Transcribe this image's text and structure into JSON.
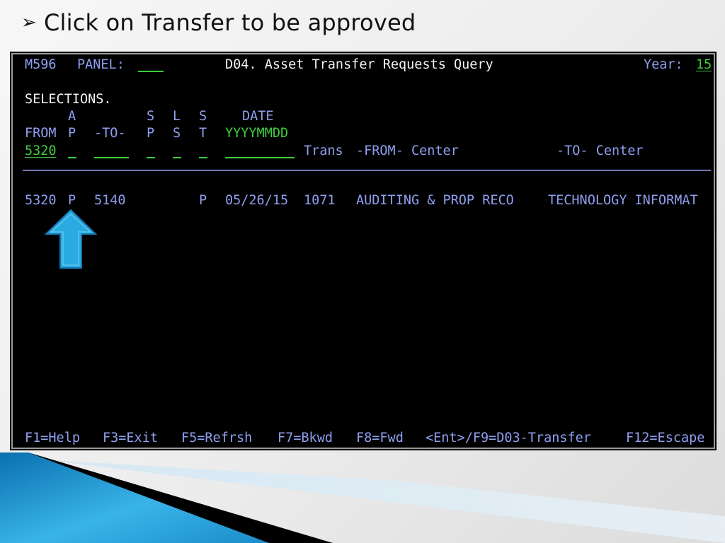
{
  "slide": {
    "bullet_icon": "arrowhead-bullet",
    "instruction": "Click on Transfer to be approved"
  },
  "terminal": {
    "program_id": "M596",
    "panel_label": "PANEL:",
    "panel_value": "",
    "screen_title": "D04. Asset Transfer Requests Query",
    "year_label": "Year:",
    "year_value": "15",
    "selections_label": "SELECTIONS.",
    "headers": {
      "row1": {
        "ap": "A",
        "sp": "S",
        "ls": "L",
        "st": "S",
        "date": "DATE"
      },
      "row2": {
        "from": "FROM",
        "ap": "P",
        "to": "-TO-",
        "sp": "P",
        "ls": "S",
        "st": "T",
        "date": "YYYYMMDD"
      }
    },
    "inputs": {
      "from": "5320",
      "ap": "",
      "to": "",
      "sp": "",
      "ls": "",
      "st": "",
      "date": ""
    },
    "result_headers": {
      "trans": "Trans",
      "from_center": "-FROM- Center",
      "to_center": "-TO- Center"
    },
    "rows": [
      {
        "from": "5320",
        "ap": "P",
        "to": "5140",
        "sp": "",
        "ls": "",
        "st": "P",
        "date": "05/26/15",
        "trans": "1071",
        "from_center": "AUDITING & PROP RECO",
        "to_center": "TECHNOLOGY INFORMAT"
      }
    ],
    "function_keys": [
      "F1=Help",
      "F3=Exit",
      "F5=Refrsh",
      "F7=Bkwd",
      "F8=Fwd",
      "<Ent>/F9=D03-Transfer",
      "F12=Escape"
    ]
  },
  "annotation": {
    "pointer_icon": "up-arrow",
    "color": "#29abe2"
  },
  "colors": {
    "terminal_bg": "#000000",
    "text_blue": "#8f9ff0",
    "text_white": "#f2f2f2",
    "text_green": "#3fcc3f",
    "accent_blue": "#1b9ad6"
  }
}
